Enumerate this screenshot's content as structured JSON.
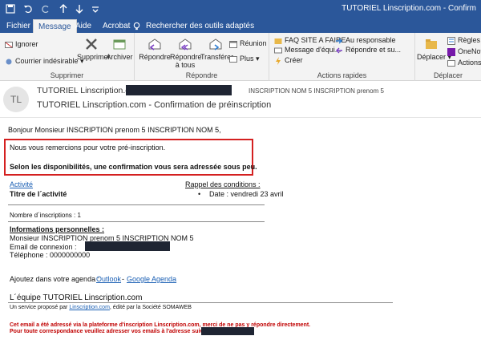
{
  "titlebar": {
    "title": "TUTORIEL Linscription.com - Confirm",
    "icons": [
      "save-icon",
      "undo-icon",
      "redo-icon",
      "up-icon",
      "down-icon",
      "customize-icon"
    ]
  },
  "tabs": [
    {
      "label": "Fichier",
      "active": false
    },
    {
      "label": "Message",
      "active": true
    },
    {
      "label": "Aide",
      "active": false
    },
    {
      "label": "Acrobat",
      "active": false
    }
  ],
  "search": {
    "label": "Rechercher des outils adaptés"
  },
  "ribbon": {
    "supprimer": {
      "ignorer": "Ignorer",
      "courrier": "Courrier indésirable",
      "supprimer": "Supprimer",
      "archiver": "Archiver",
      "group_label": "Supprimer"
    },
    "repondre": {
      "repondre": "Répondre",
      "repondre_tous_1": "Répondre",
      "repondre_tous_2": "à tous",
      "transferer": "Transférer",
      "reunion": "Réunion",
      "plus": "Plus",
      "group_label": "Répondre"
    },
    "actions": {
      "items": [
        "FAQ SITE A FAIRE",
        "Message d'équi...",
        "Créer",
        "Au responsable",
        "Répondre et su..."
      ],
      "group_label": "Actions rapides"
    },
    "deplacer": {
      "deplacer": "Déplacer",
      "regles": "Règles",
      "onenote": "OneNote",
      "actions": "Actions",
      "group_label": "Déplacer"
    }
  },
  "message": {
    "avatar": "TL",
    "sender": "TUTORIEL Linscription.com",
    "to": "INSCRIPTION NOM 5 INSCRIPTION prenom 5",
    "subject": "TUTORIEL Linscription.com - Confirmation de préinscription"
  },
  "body": {
    "greeting": "Bonjour Monsieur INSCRIPTION prenom 5 INSCRIPTION NOM 5,",
    "thanks": "Nous vous remercions pour votre pré-inscription.",
    "availability": "Selon les disponibilités, une confirmation vous sera adressée sous peu.",
    "activite_link": "Activité",
    "activite_title": "Titre de l´activité",
    "rappel_label": "Rappel des conditions :",
    "date_line": "Date : vendredi 23 avril",
    "nb_inscriptions": "Nombre d´inscriptions : 1",
    "info_title": "Informations personnelles :",
    "info_name": "Monsieur INSCRIPTION prenom 5 INSCRIPTION NOM 5",
    "info_email": "Email de connexion :",
    "info_phone": "Téléphone : 0000000000",
    "agenda_text": "Ajoutez dans votre agenda :",
    "agenda_outlook": "Outlook",
    "agenda_sep": "-",
    "agenda_google": "Google Agenda",
    "team": "L´équipe TUTORIEL Linscription.com",
    "service_prefix": "Un service proposé par",
    "service_link": "Linscription.com",
    "service_suffix": ", édité par la Société SOMAWEB",
    "footer_1": "Cet email a été adressé via la plateforme d'inscription Linscription.com, merci de ne pas y répondre directement.",
    "footer_2": "Pour toute correspondance veuillez adresser vos emails à l'adresse suivante :"
  },
  "colors": {
    "brand": "#2b579a",
    "accent_red": "#d42020",
    "redaction": "#1f2533"
  }
}
